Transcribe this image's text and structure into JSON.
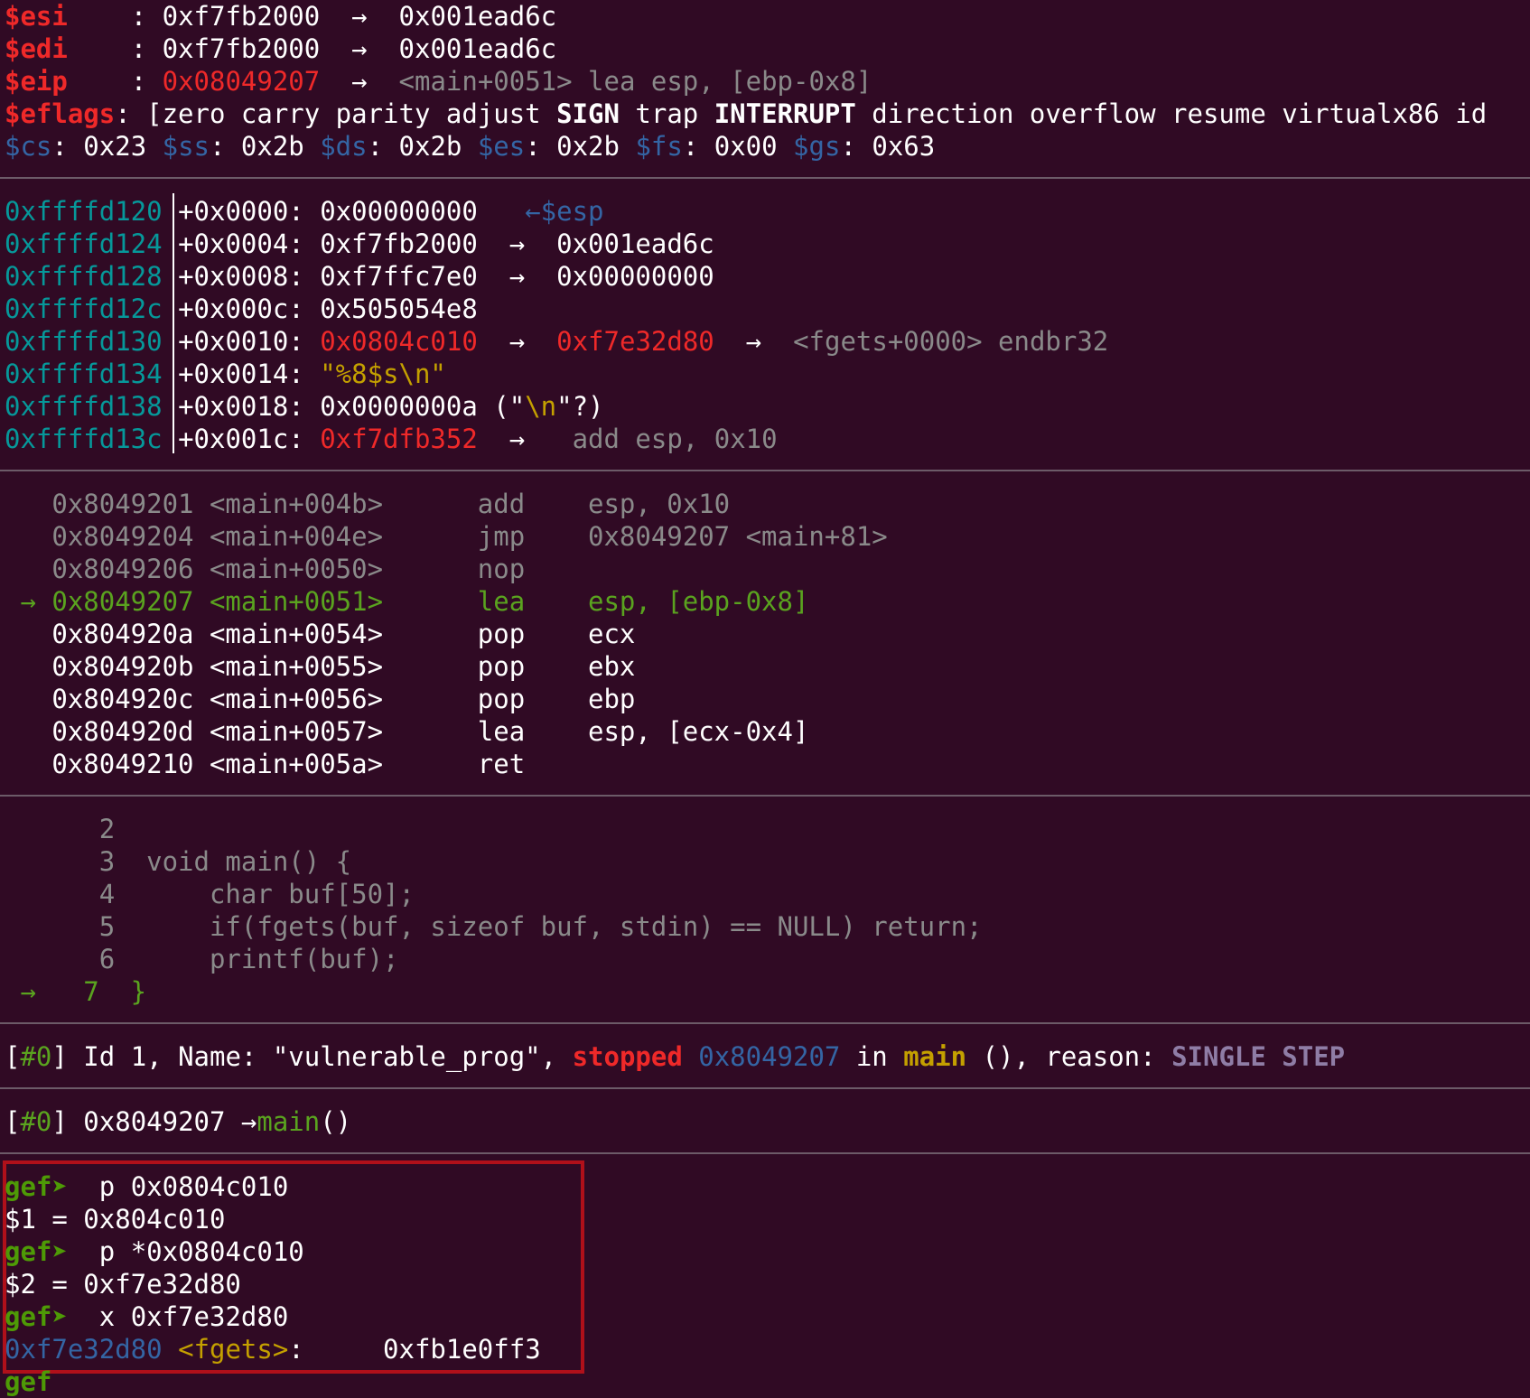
{
  "registers": {
    "esi": {
      "name": "$esi",
      "sep": ": ",
      "val": "0xf7fb2000",
      "arrow": "→",
      "deref": "0x001ead6c"
    },
    "edi": {
      "name": "$edi",
      "sep": ": ",
      "val": "0xf7fb2000",
      "arrow": "→",
      "deref": "0x001ead6c"
    },
    "eip": {
      "name": "$eip",
      "sep": ": ",
      "val": "0x08049207",
      "arrow": "→",
      "deref": "<main+0051> lea esp, [ebp-0x8]"
    },
    "eflags": {
      "name": "$eflags",
      "open": ": [zero carry parity adjust ",
      "sign": "SIGN",
      "mid": " trap ",
      "interrupt": "INTERRUPT",
      "rest": " direction overflow resume virtualx86 id"
    },
    "segments": [
      {
        "name": "$cs",
        "val": ": 0x23 "
      },
      {
        "name": "$ss",
        "val": ": 0x2b "
      },
      {
        "name": "$ds",
        "val": ": 0x2b "
      },
      {
        "name": "$es",
        "val": ": 0x2b "
      },
      {
        "name": "$fs",
        "val": ": 0x00 "
      },
      {
        "name": "$gs",
        "val": ": 0x63"
      }
    ]
  },
  "stack": [
    {
      "addr": "0xffffd120",
      "off": "+0x0000: ",
      "val": "0x00000000",
      "tail1": "   ←",
      "tail2": "$esp"
    },
    {
      "addr": "0xffffd124",
      "off": "+0x0004: ",
      "val": "0xf7fb2000",
      "tail1": "  →  0x001ead6c"
    },
    {
      "addr": "0xffffd128",
      "off": "+0x0008: ",
      "val": "0xf7ffc7e0",
      "tail1": "  →  0x00000000"
    },
    {
      "addr": "0xffffd12c",
      "off": "+0x000c: ",
      "val": "0x505054e8"
    },
    {
      "addr": "0xffffd130",
      "off": "+0x0010: ",
      "val": "0x0804c010",
      "a1": "  →  ",
      "v2": "0xf7e32d80",
      "a2": "  →  ",
      "g": "<fgets+0000> endbr32"
    },
    {
      "addr": "0xffffd134",
      "off": "+0x0014: ",
      "str": "\"%8$s\\n\""
    },
    {
      "addr": "0xffffd138",
      "off": "+0x0018: ",
      "val": "0x0000000a",
      "p1": " (\"",
      "nl": "\\n",
      "p2": "\"?)"
    },
    {
      "addr": "0xffffd13c",
      "off": "+0x001c: ",
      "val": "0xf7dfb352",
      "a1": "  →   ",
      "g": "add esp, 0x10"
    }
  ],
  "disasm": [
    {
      "marker": "  ",
      "text": " 0x8049201 <main+004b>      add    esp, 0x10"
    },
    {
      "marker": "  ",
      "text": " 0x8049204 <main+004e>      jmp    0x8049207 <main+81>"
    },
    {
      "marker": "  ",
      "text": " 0x8049206 <main+0050>      nop"
    },
    {
      "marker": " →",
      "text": " 0x8049207 <main+0051>      lea    esp, [ebp-0x8]"
    },
    {
      "marker": "  ",
      "text": " 0x804920a <main+0054>      pop    ecx"
    },
    {
      "marker": "  ",
      "text": " 0x804920b <main+0055>      pop    ebx"
    },
    {
      "marker": "  ",
      "text": " 0x804920c <main+0056>      pop    ebp"
    },
    {
      "marker": "  ",
      "text": " 0x804920d <main+0057>      lea    esp, [ecx-0x4]"
    },
    {
      "marker": "  ",
      "text": " 0x8049210 <main+005a>      ret"
    }
  ],
  "source": [
    {
      "marker": "  ",
      "text": "    2"
    },
    {
      "marker": "  ",
      "text": "    3  void main() {"
    },
    {
      "marker": "  ",
      "text": "    4      char buf[50];"
    },
    {
      "marker": "  ",
      "text": "    5      if(fgets(buf, sizeof buf, stdin) == NULL) return;"
    },
    {
      "marker": "  ",
      "text": "    6      printf(buf);"
    },
    {
      "marker": " →",
      "text": "   7  }"
    }
  ],
  "threads": {
    "b1": "[",
    "id": "#0",
    "b2": "] Id 1, Name: \"vulnerable_prog\", ",
    "stopped": "stopped",
    "sp": " ",
    "addr": "0x8049207",
    "in": " in ",
    "fn": "main",
    "rest": " (), reason: ",
    "reason": "SINGLE STEP"
  },
  "trace": {
    "b1": "[",
    "id": "#0",
    "b2": "] 0x8049207 →",
    "fn": "main",
    "tail": "()"
  },
  "console": {
    "prompt": "gef➤ ",
    "lines": [
      {
        "cmd": " p 0x0804c010"
      },
      {
        "out": "$1 = 0x804c010"
      },
      {
        "cmd": " p *0x0804c010"
      },
      {
        "out": "$2 = 0xf7e32d80"
      },
      {
        "cmd": " x 0xf7e32d80"
      }
    ],
    "last": {
      "addr": "0xf7e32d80",
      "sp": " ",
      "sym": "<fgets>",
      "rest": ":     0xfb1e0ff3"
    },
    "partial": "gef"
  }
}
